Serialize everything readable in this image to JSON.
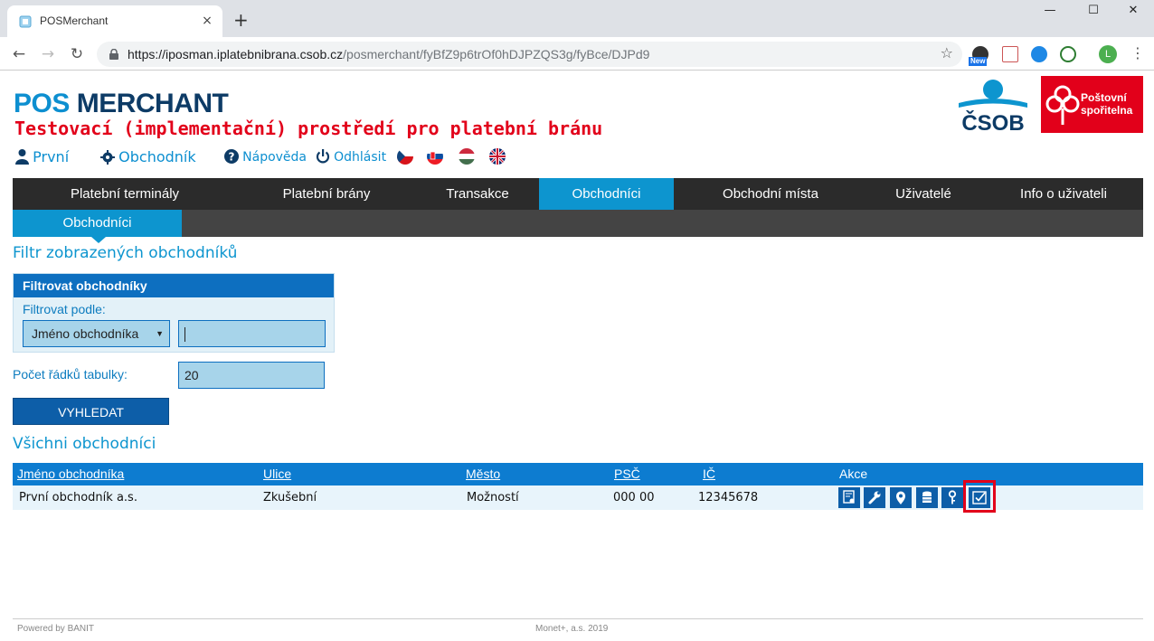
{
  "browser": {
    "tab_title": "POSMerchant",
    "tab_close": "×",
    "new_tab": "+",
    "url_host": "https://iposman.iplatebnibrana.csob.cz",
    "url_path": "/posmerchant/fyBfZ9p6trOf0hDJPZQS3g/fyBce/DJPd9",
    "ext_badge": "New",
    "profile_initial": "L",
    "win_minimize": "—",
    "win_maximize": "☐",
    "win_close": "✕"
  },
  "header": {
    "logo_part1": "POS",
    "logo_part2": "MERCHANT",
    "environment_title": "Testovací (implementační) prostředí pro platební bránu",
    "user_name": "První",
    "merchant_label": "Obchodník",
    "help_label": "Nápověda",
    "logout_label": "Odhlásit",
    "languages": [
      "cs",
      "sk",
      "hu",
      "en"
    ],
    "csob_logo_text": "ČSOB",
    "ps_logo_line1": "Poštovní",
    "ps_logo_line2": "spořitelna"
  },
  "colors": {
    "accent": "#0d95cf",
    "dark_nav": "#2b2b2b",
    "environment_red": "#e2001a",
    "button_blue": "#0d5ea8",
    "table_head": "#0d7cd0"
  },
  "main_menu": [
    {
      "label": "Platební terminály",
      "active": false
    },
    {
      "label": "Platební brány",
      "active": false
    },
    {
      "label": "Transakce",
      "active": false
    },
    {
      "label": "Obchodníci",
      "active": true
    },
    {
      "label": "Obchodní místa",
      "active": false
    },
    {
      "label": "Uživatelé",
      "active": false
    },
    {
      "label": "Info o uživateli",
      "active": false
    }
  ],
  "sub_menu": {
    "active_label": "Obchodníci"
  },
  "filter": {
    "section_title": "Filtr zobrazených obchodníků",
    "box_title": "Filtrovat obchodníky",
    "filter_by_label": "Filtrovat podle:",
    "filter_by_value": "Jméno obchodníka",
    "search_value": "",
    "rows_label": "Počet řádků tabulky:",
    "rows_value": "20",
    "search_button": "VYHLEDAT"
  },
  "table": {
    "section_title": "Všichni obchodníci",
    "columns": [
      "Jméno obchodníka",
      "Ulice",
      "Město",
      "PSČ",
      "IČ",
      "Akce"
    ],
    "rows": [
      {
        "name": "První obchodník a.s.",
        "street": "Zkušební",
        "city": "Možností",
        "zip": "000 00",
        "ic": "12345678"
      }
    ],
    "actions": [
      "certificate-icon",
      "wrench-icon",
      "location-pin-icon",
      "database-icon",
      "key-icon",
      "checkbox-icon"
    ]
  },
  "footer": {
    "left": "Powered by BANIT",
    "center": "Monet+, a.s. 2019"
  }
}
